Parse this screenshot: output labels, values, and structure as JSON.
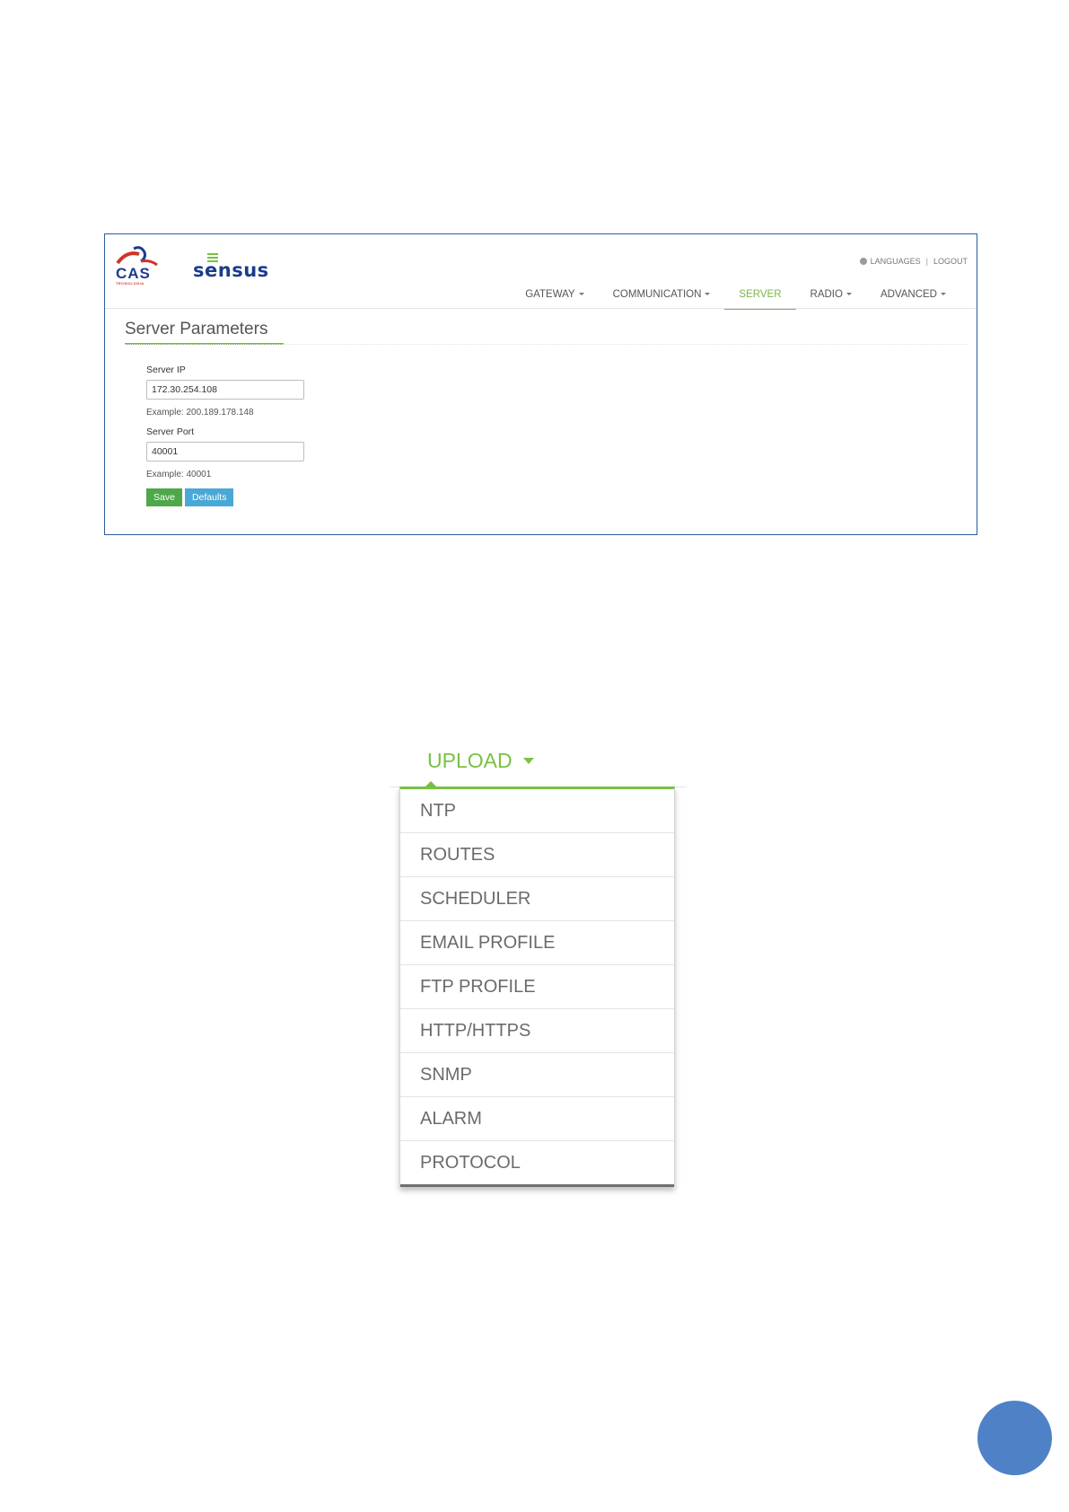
{
  "header": {
    "logo_cas": "CAS",
    "logo_cas_sub": "TECNOLOGIA",
    "logo_sensus": "sensus",
    "links": [
      "LANGUAGES",
      "LOGOUT"
    ]
  },
  "nav": {
    "items": [
      {
        "label": "GATEWAY",
        "dropdown": true
      },
      {
        "label": "COMMUNICATION",
        "dropdown": true
      },
      {
        "label": "SERVER",
        "dropdown": false,
        "active": true
      },
      {
        "label": "RADIO",
        "dropdown": true
      },
      {
        "label": "ADVANCED",
        "dropdown": true
      }
    ]
  },
  "server_params": {
    "title": "Server Parameters",
    "ip_label": "Server IP",
    "ip_value": "172.30.254.108",
    "ip_hint": "Example: 200.189.178.148",
    "port_label": "Server Port",
    "port_value": "40001",
    "port_hint": "Example: 40001",
    "save_label": "Save",
    "defaults_label": "Defaults"
  },
  "upload_menu": {
    "title": "UPLOAD",
    "items": [
      "NTP",
      "ROUTES",
      "SCHEDULER",
      "EMAIL PROFILE",
      "FTP PROFILE",
      "HTTP/HTTPS",
      "SNMP",
      "ALARM",
      "PROTOCOL"
    ]
  },
  "colors": {
    "accent_green": "#7ac143",
    "brand_blue": "#1b3c8c",
    "save_button": "#4ea84a",
    "defaults_button": "#4aa8d6",
    "page_badge": "#4f81c7"
  }
}
